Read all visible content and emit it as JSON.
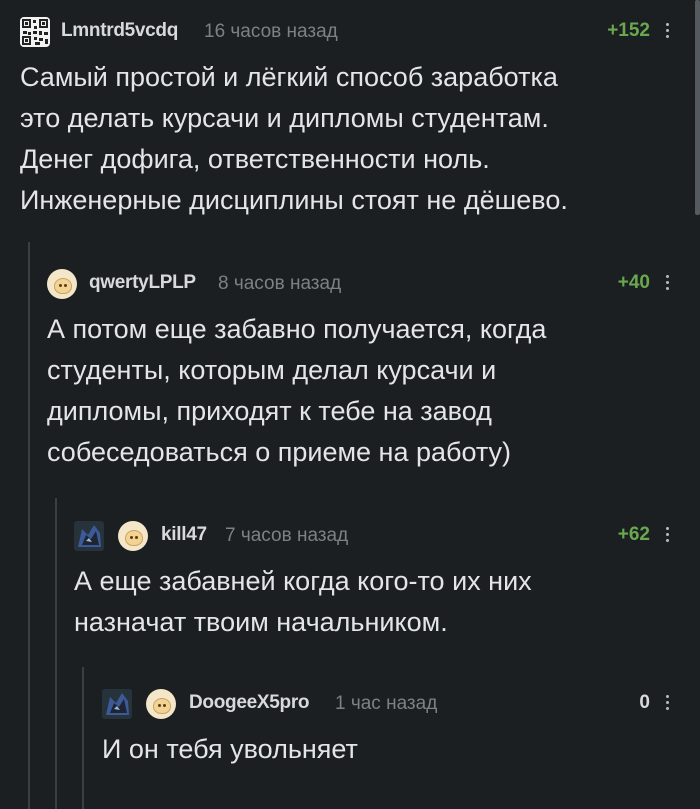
{
  "comments": [
    {
      "username": "Lmntrd5vcdq",
      "time": "16 часов назад",
      "rating": "+152",
      "text": "Самый простой и лёгкий способ заработка\nэто делать курсачи и дипломы студентам.\nДенег дофига, ответственности ноль.\nИнженерные дисциплины стоят не дёшево."
    },
    {
      "username": "qwertyLPLP",
      "time": "8 часов назад",
      "rating": "+40",
      "text": "А потом еще забавно получается, когда\nстуденты, которым делал курсачи и\nдипломы, приходят к тебе на завод\nсобеседоваться о приеме на работу)"
    },
    {
      "username": "kill47",
      "time": "7 часов назад",
      "rating": "+62",
      "text": "А еще забавней когда кого-то их них\nназначат твоим начальником."
    },
    {
      "username": "DoogeeX5pro",
      "time": "1 час назад",
      "rating": "0",
      "text": "И он тебя увольняет"
    }
  ],
  "colors": {
    "background": "#1c1f21",
    "positive_rating": "#6aa84f",
    "thread_line": "#3a3f43"
  }
}
